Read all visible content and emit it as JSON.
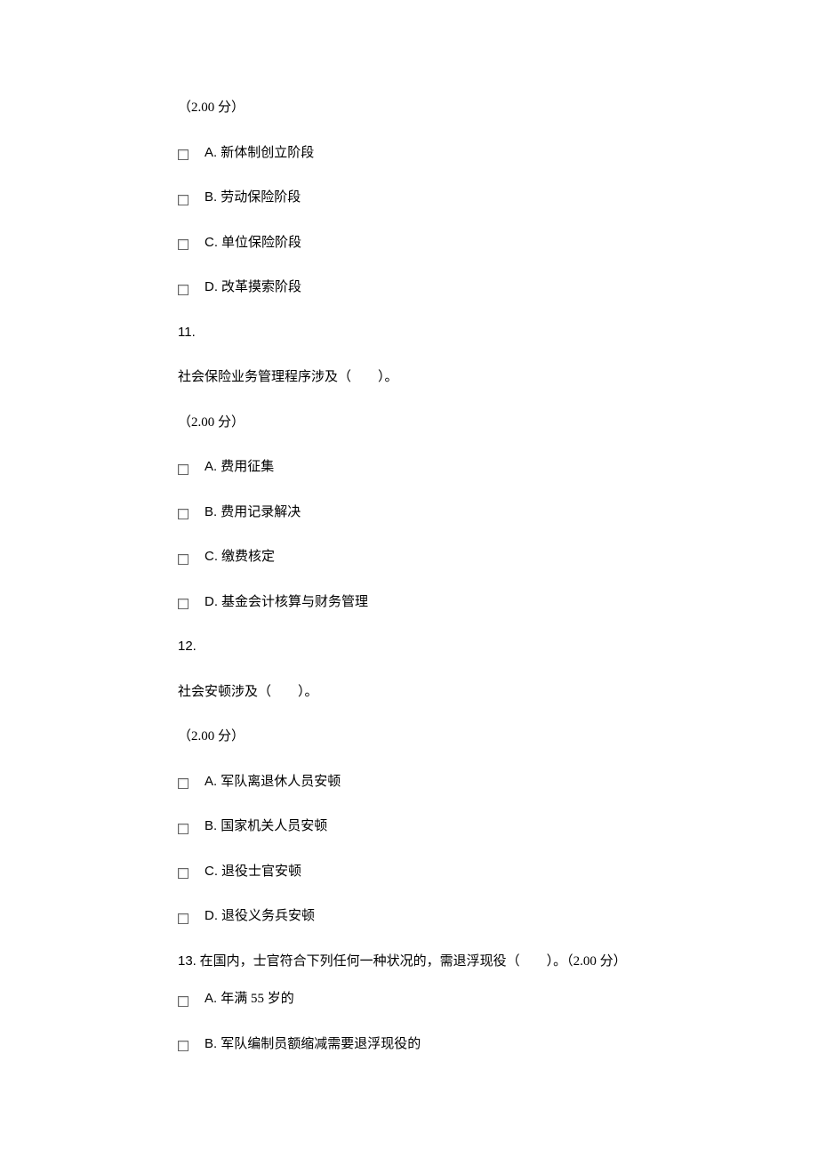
{
  "q10": {
    "points_text": "（2.00 分）",
    "options": [
      {
        "label": "A.",
        "text": "新体制创立阶段"
      },
      {
        "label": "B.",
        "text": "劳动保险阶段"
      },
      {
        "label": "C.",
        "text": "单位保险阶段"
      },
      {
        "label": "D.",
        "text": "改革摸索阶段"
      }
    ]
  },
  "q11": {
    "number": "11.",
    "stem": "社会保险业务管理程序涉及（　　）。",
    "points_text": "（2.00 分）",
    "options": [
      {
        "label": "A.",
        "text": "费用征集"
      },
      {
        "label": "B.",
        "text": "费用记录解决"
      },
      {
        "label": "C.",
        "text": "缴费核定"
      },
      {
        "label": "D.",
        "text": "基金会计核算与财务管理"
      }
    ]
  },
  "q12": {
    "number": "12.",
    "stem": "社会安顿涉及（　　）。",
    "points_text": "（2.00 分）",
    "options": [
      {
        "label": "A.",
        "text": "军队离退休人员安顿"
      },
      {
        "label": "B.",
        "text": "国家机关人员安顿"
      },
      {
        "label": "C.",
        "text": "退役士官安顿"
      },
      {
        "label": "D.",
        "text": "退役义务兵安顿"
      }
    ]
  },
  "q13": {
    "number": "13.",
    "stem": "在国内，士官符合下列任何一种状况的，需退浮现役（　　）。（2.00 分）",
    "options": [
      {
        "label": "A.",
        "text": "年满 55 岁的"
      },
      {
        "label": "B.",
        "text": "军队编制员额缩减需要退浮现役的"
      }
    ]
  }
}
